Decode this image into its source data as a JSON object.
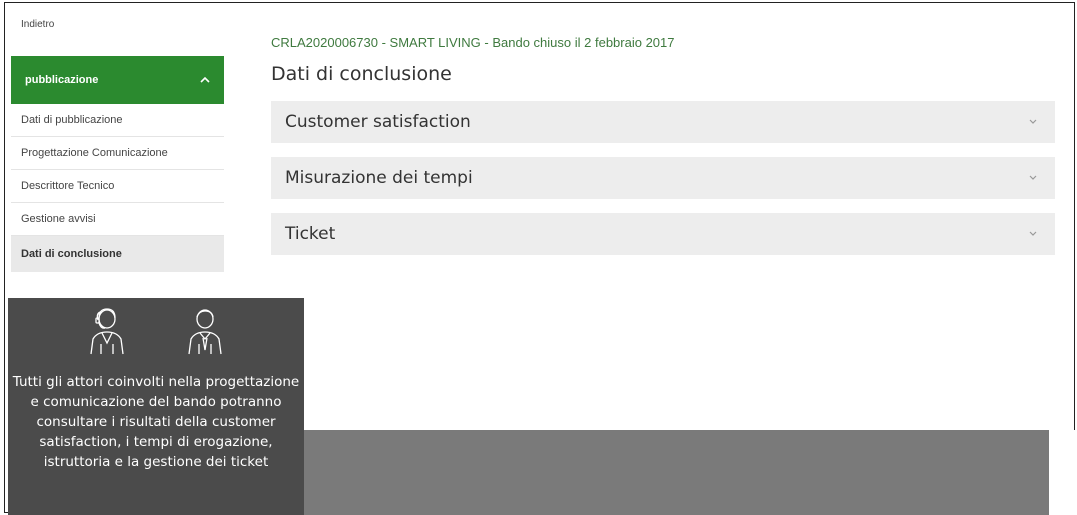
{
  "back": {
    "label": "Indietro"
  },
  "sidebar": {
    "header": "pubblicazione",
    "header_icon": "chevron-up-icon",
    "items": [
      {
        "label": "Dati di pubblicazione"
      },
      {
        "label": "Progettazione Comunicazione"
      },
      {
        "label": "Descrittore Tecnico"
      },
      {
        "label": "Gestione avvisi"
      },
      {
        "label": "Dati di conclusione",
        "active": true
      }
    ]
  },
  "main": {
    "breadcrumb": "CRLA2020006730 - SMART LIVING - Bando chiuso il 2 febbraio 2017",
    "title": "Dati di conclusione",
    "accordions": [
      {
        "label": "Customer satisfaction",
        "icon": "chevron-down-icon"
      },
      {
        "label": "Misurazione dei tempi",
        "icon": "chevron-down-icon"
      },
      {
        "label": "Ticket",
        "icon": "chevron-down-icon"
      }
    ]
  },
  "overlay": {
    "icons": [
      "female-operator-icon",
      "male-operator-icon"
    ],
    "text": "Tutti gli attori coinvolti nella progettazione e comunicazione del bando potranno consultare i risultati della customer satisfaction, i tempi di erogazione, istruttoria e la gestione dei ticket"
  },
  "colors": {
    "menu_header_bg": "#2b8a2f",
    "breadcrumb_text": "#3f7a3f",
    "accordion_bg": "#ededed",
    "overlay_bg": "#4b4b4b",
    "band_bg": "#7a7a7a"
  }
}
